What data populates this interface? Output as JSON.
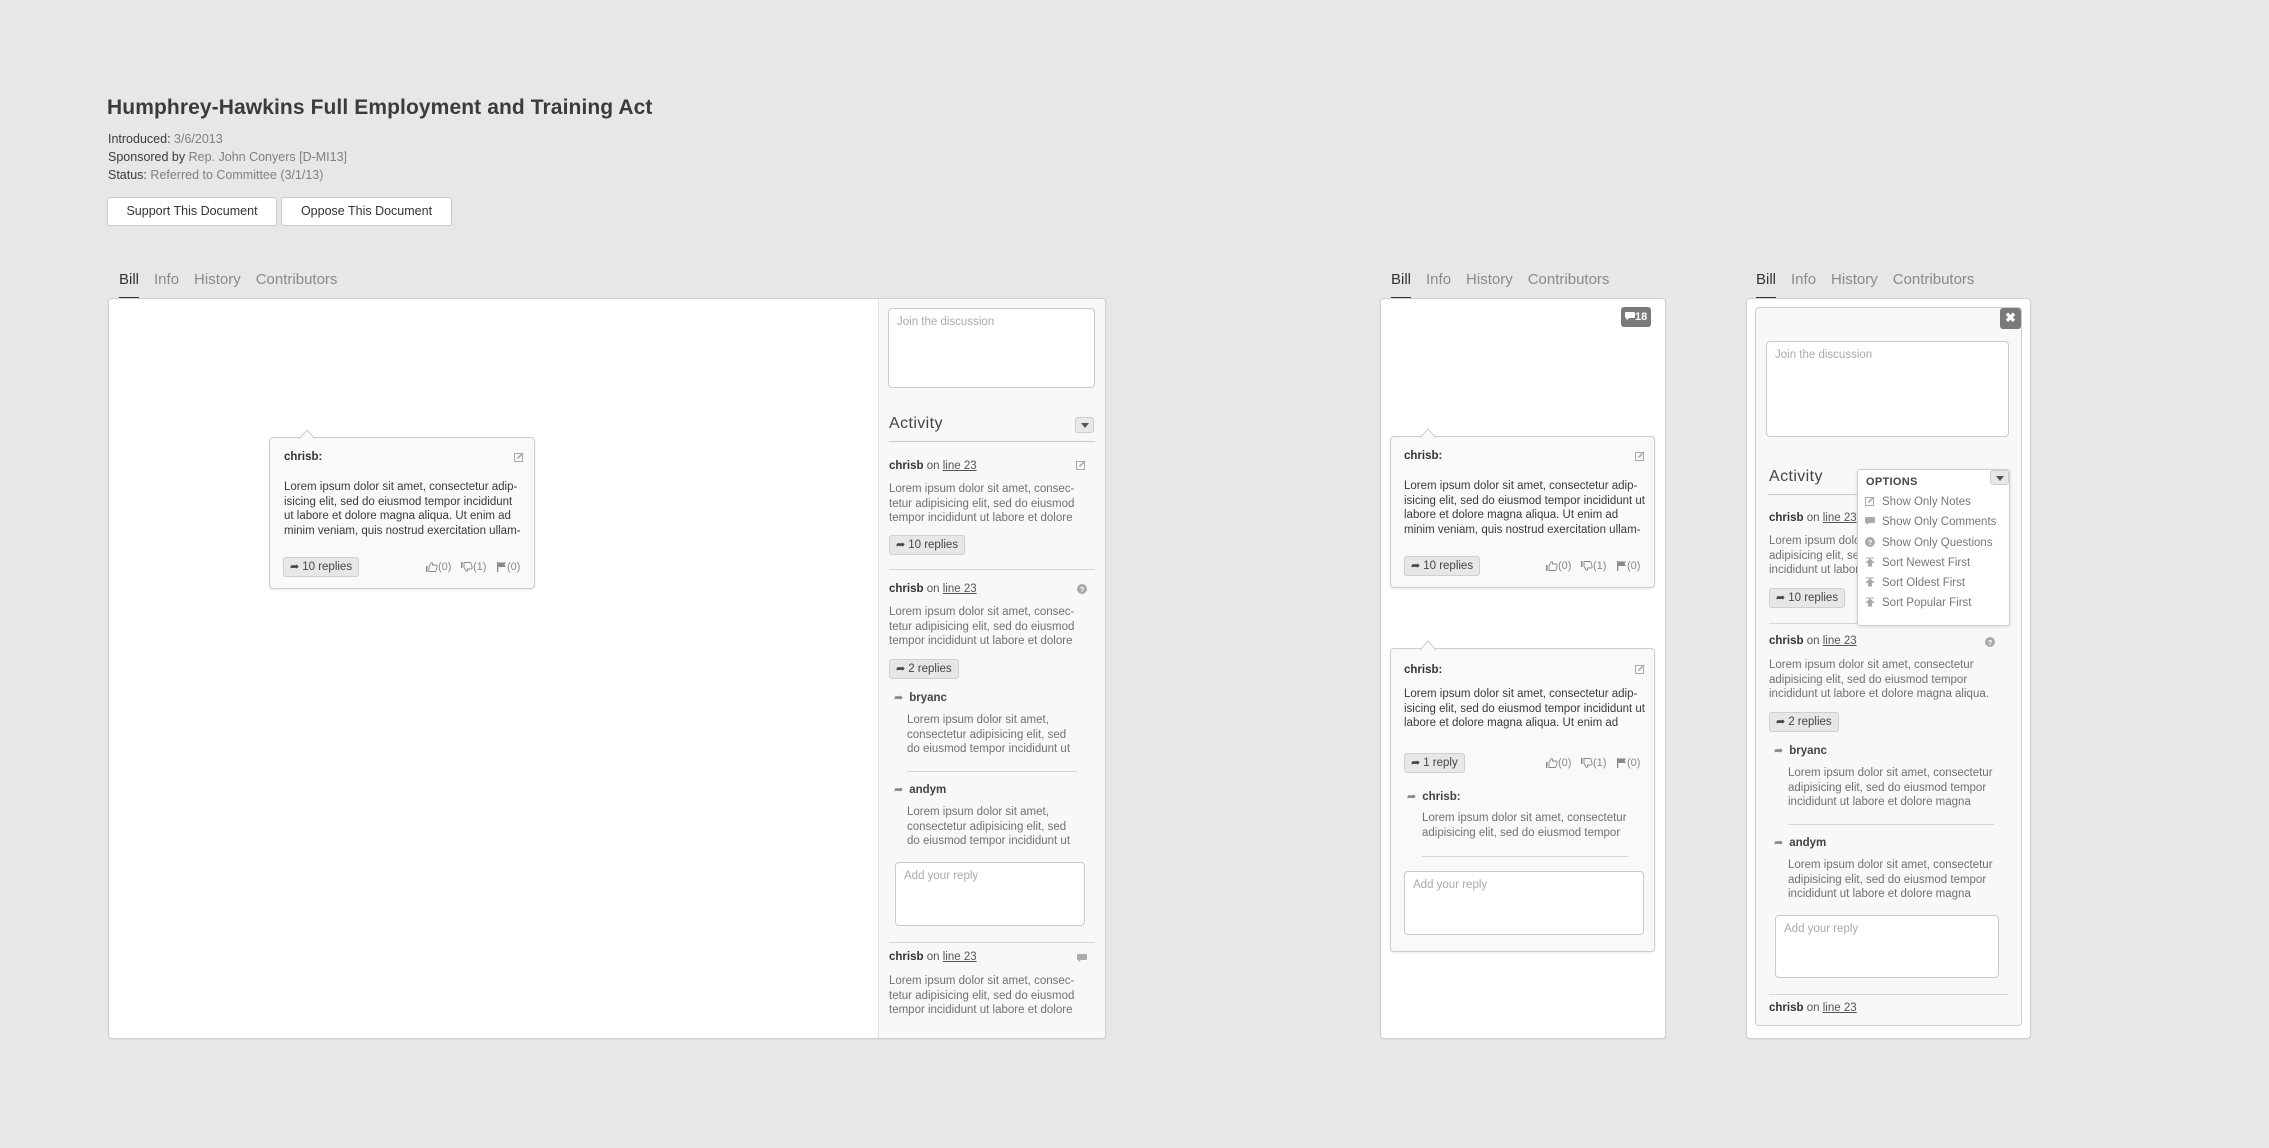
{
  "document": {
    "title": "Humphrey-Hawkins Full Employment and Training Act",
    "introduced_label": "Introduced:",
    "introduced_value": "3/6/2013",
    "sponsor_label": "Sponsored by",
    "sponsor_value": "Rep. John Conyers [D-MI13]",
    "status_label": "Status:",
    "status_value": "Referred to Committee (3/1/13)",
    "support_label": "Support This Document",
    "oppose_label": "Oppose This Document"
  },
  "tabs": [
    "Bill",
    "Info",
    "History",
    "Contributors"
  ],
  "active_tab": "Bill",
  "lorem": {
    "card_long": "Lorem ipsum dolor sit amet, consectetur adip- isicing elit, sed do eiusmod tempor incididunt ut labore et dolore magna aliqua. Ut enim ad minim veniam, quis nostrud exercitation ullam-",
    "card_short": "Lorem ipsum dolor sit amet, consectetur adip- isicing elit, sed do eiusmod tempor incididunt ut labore et dolore magna aliqua. Ut enim ad",
    "activity": "Lorem ipsum dolor sit amet, consec- tetur adipisicing elit, sed do eiusmod tempor incididunt ut labore et dolore",
    "activity_wide": "Lorem ipsum dolor sit amet, consectetur adipisicing elit, sed do eiusmod tempor incididunt ut labore et dolore magna aliqua.",
    "reply_narrow": "Lorem ipsum dolor sit amet, consectetur adipisicing elit, sed do eiusmod tempor incididunt ut",
    "reply_wide": "Lorem ipsum dolor sit amet, consectetur adipisicing elit, sed do eiusmod tempor incididunt ut labore et dolore magna",
    "reply_card": "Lorem ipsum dolor sit amet, consectetur adipisicing elit, sed do eiusmod tempor"
  },
  "common": {
    "join_placeholder": "Join the discussion",
    "reply_placeholder": "Add your reply",
    "activity_heading": "Activity",
    "on": "on",
    "line_ref": "line 23"
  },
  "annotation_card": {
    "author": "chrisb:",
    "replies_label": "10 replies",
    "likes": "(0)",
    "dislikes": "(1)",
    "flags": "(0)"
  },
  "activity": [
    {
      "author": "chrisb",
      "type": "note",
      "replies_label": "10 replies"
    },
    {
      "author": "chrisb",
      "type": "question",
      "replies_label": "2 replies",
      "replies": [
        {
          "author": "bryanc"
        },
        {
          "author": "andym"
        }
      ]
    },
    {
      "author": "chrisb",
      "type": "comment"
    }
  ],
  "mobile": {
    "comment_count": "18",
    "card1": {
      "author": "chrisb:",
      "replies_label": "10 replies",
      "likes": "(0)",
      "dislikes": "(1)",
      "flags": "(0)"
    },
    "card2": {
      "author": "chrisb:",
      "replies_label": "1 reply",
      "likes": "(0)",
      "dislikes": "(1)",
      "flags": "(0)",
      "reply": {
        "author": "chrisb:"
      }
    }
  },
  "options_menu": {
    "title": "OPTIONS",
    "items": [
      {
        "label": "Show Only Notes",
        "icon": "note-icon"
      },
      {
        "label": "Show Only Comments",
        "icon": "comment-icon"
      },
      {
        "label": "Show Only Questions",
        "icon": "question-icon"
      },
      {
        "label": "Sort Newest First",
        "icon": "sort-icon"
      },
      {
        "label": "Sort Oldest First",
        "icon": "sort-icon"
      },
      {
        "label": "Sort Popular First",
        "icon": "sort-icon"
      }
    ]
  },
  "colors": {
    "background": "#e6e7e9",
    "badge": "#7a7a7a",
    "text": "#3a3a3a",
    "muted": "#808080"
  }
}
